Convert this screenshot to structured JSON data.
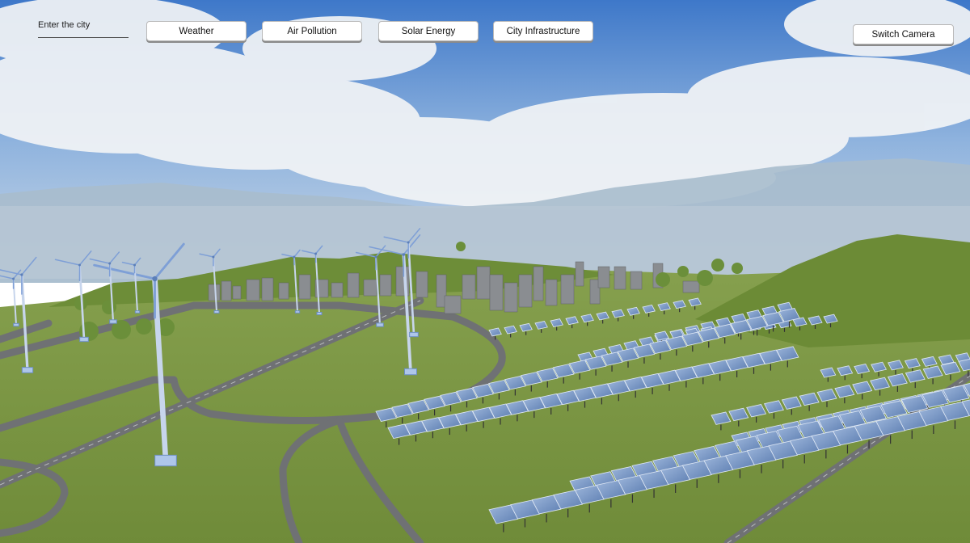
{
  "search": {
    "placeholder": "Enter the city"
  },
  "toolbar": {
    "weather_label": "Weather",
    "air_pollution_label": "Air Pollution",
    "solar_energy_label": "Solar Energy",
    "city_infrastructure_label": "City Infrastructure",
    "switch_camera_label": "Switch Camera"
  },
  "colors": {
    "sky_top": "#3f7fd0",
    "sky_horizon": "#c9d8e8",
    "haze": "#aebfcf",
    "grass": "#78923f",
    "hill": "#6f8e3a",
    "road": "#6b6d70",
    "panel": "#7a9bc9",
    "turbine": "#b9cbe8"
  }
}
